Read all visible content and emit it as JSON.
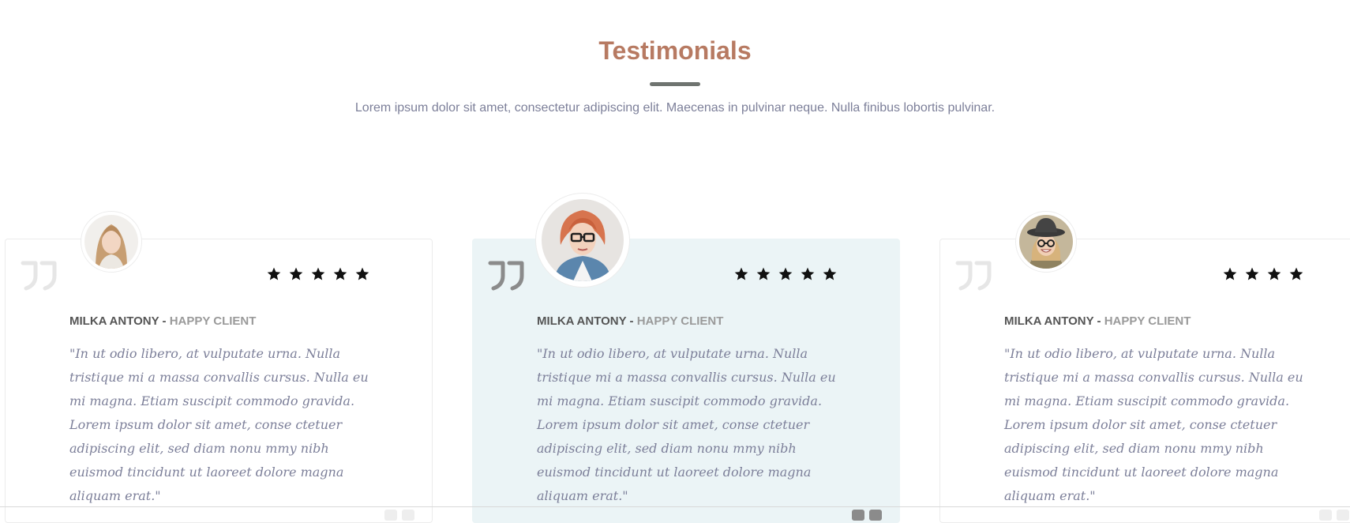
{
  "section": {
    "title": "Testimonials",
    "subtitle": "Lorem ipsum dolor sit amet, consectetur adipiscing elit. Maecenas in pulvinar neque. Nulla finibus lobortis pulvinar."
  },
  "colors": {
    "title": "#b77a62",
    "divider": "#6f7470",
    "body_text": "#7c7f99",
    "featured_card_bg": "#ebf4f6",
    "star": "#111111",
    "quote_icon_light": "#e6e6e6",
    "quote_icon_dark": "#8b8b8b"
  },
  "testimonials": [
    {
      "client_name": "MILKA ANTONY",
      "separator": " - ",
      "client_role": "HAPPY CLIENT",
      "rating": 5,
      "quote": "\"In ut odio libero, at vulputate urna. Nulla tristique mi a massa convallis cursus. Nulla eu mi magna. Etiam suscipit commodo gravida. Lorem ipsum dolor sit amet, conse ctetuer adipiscing elit, sed diam nonu mmy nibh euismod tincidunt ut laoreet dolore magna aliquam erat.\"",
      "avatar_icon": "woman-blonde-avatar-icon",
      "quote_icon": "quote-mark-icon",
      "featured": false
    },
    {
      "client_name": "MILKA ANTONY",
      "separator": " - ",
      "client_role": "HAPPY CLIENT",
      "rating": 5,
      "quote": "\"In ut odio libero, at vulputate urna. Nulla tristique mi a massa convallis cursus. Nulla eu mi magna. Etiam suscipit commodo gravida. Lorem ipsum dolor sit amet, conse ctetuer adipiscing elit, sed diam nonu mmy nibh euismod tincidunt ut laoreet dolore magna aliquam erat.\"",
      "avatar_icon": "woman-redhead-glasses-avatar-icon",
      "quote_icon": "quote-mark-icon",
      "featured": true
    },
    {
      "client_name": "MILKA ANTONY",
      "separator": " - ",
      "client_role": "HAPPY CLIENT",
      "rating": 4,
      "quote": "\"In ut odio libero, at vulputate urna. Nulla tristique mi a massa convallis cursus. Nulla eu mi magna. Etiam suscipit commodo gravida. Lorem ipsum dolor sit amet, conse ctetuer adipiscing elit, sed diam nonu mmy nibh euismod tincidunt ut laoreet dolore magna aliquam erat.\"",
      "avatar_icon": "woman-hat-glasses-avatar-icon",
      "quote_icon": "quote-mark-icon",
      "featured": false
    }
  ]
}
